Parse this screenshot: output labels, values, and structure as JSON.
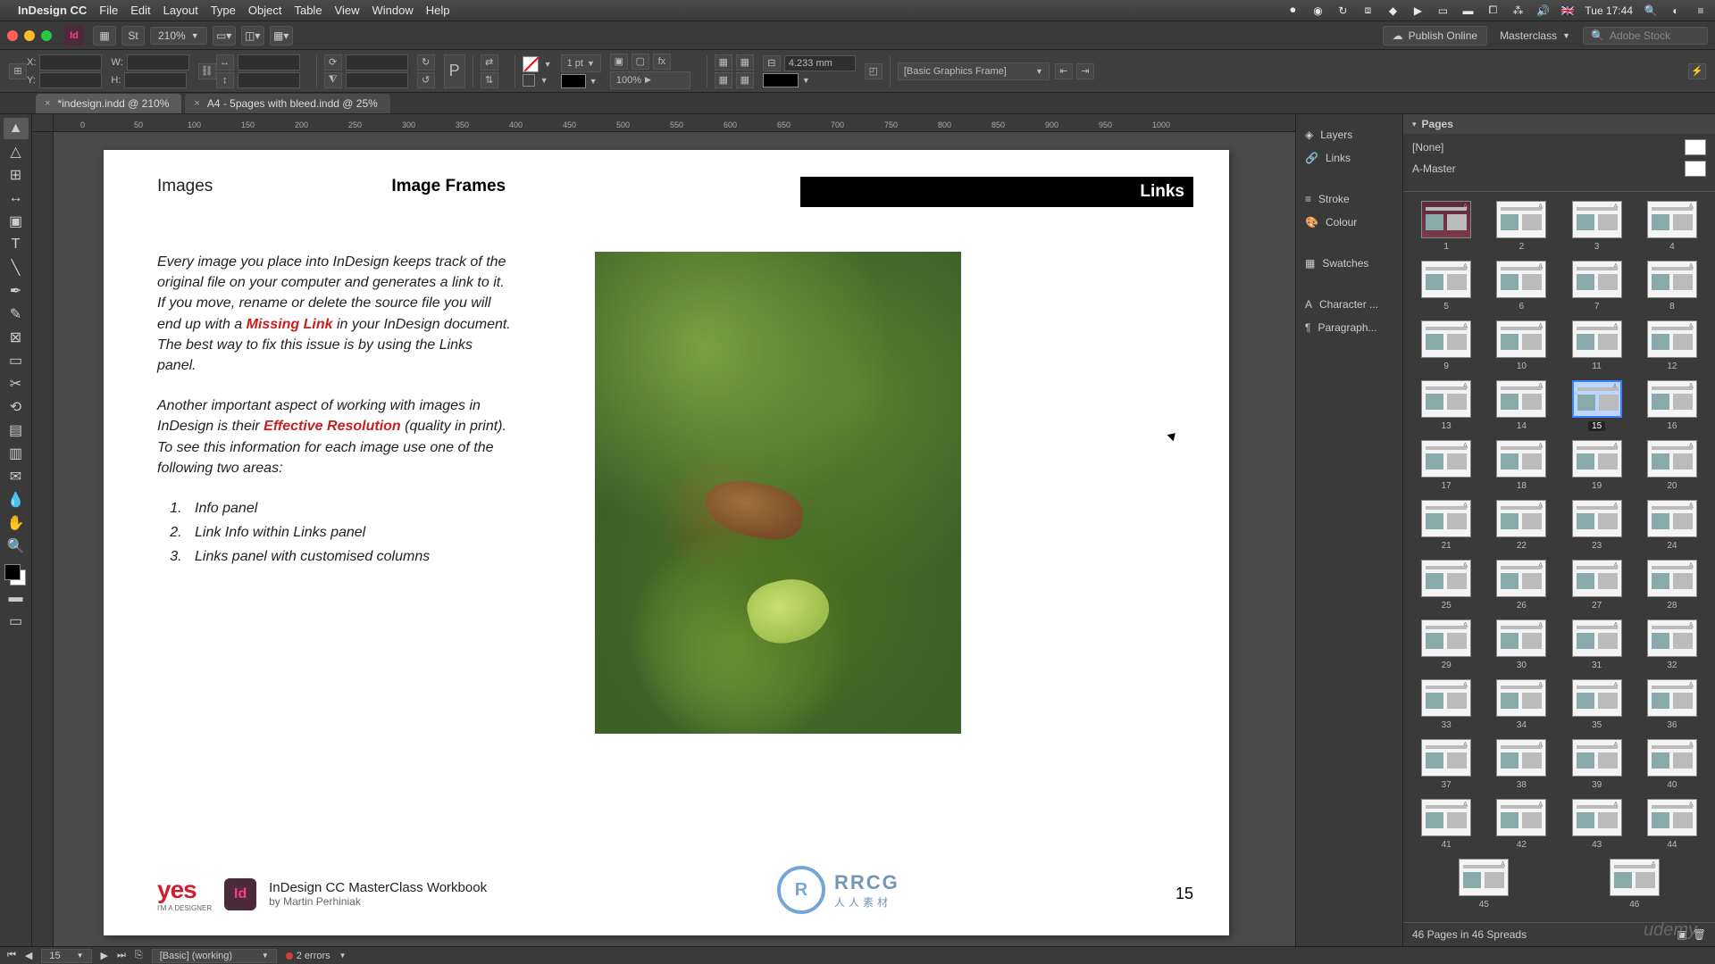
{
  "menubar": {
    "app": "InDesign CC",
    "items": [
      "File",
      "Edit",
      "Layout",
      "Type",
      "Object",
      "Table",
      "View",
      "Window",
      "Help"
    ],
    "clock": "Tue 17:44",
    "lang": "🇬🇧"
  },
  "toolbar": {
    "zoom": "210%",
    "publish": "Publish Online",
    "workspace": "Masterclass",
    "stock_placeholder": "Adobe Stock"
  },
  "control": {
    "x_label": "X:",
    "y_label": "Y:",
    "w_label": "W:",
    "h_label": "H:",
    "stroke_pt": "1 pt",
    "scale": "100%",
    "gap": "4.233 mm",
    "style": "[Basic Graphics Frame]"
  },
  "tabs": {
    "t1": "*indesign.indd @ 210%",
    "t2": "A4 - 5pages with bleed.indd @ 25%"
  },
  "ruler_marks": [
    "0",
    "50",
    "100",
    "150",
    "200",
    "250",
    "300",
    "350",
    "400",
    "450",
    "500",
    "550",
    "600",
    "650",
    "700",
    "750",
    "800",
    "850",
    "900",
    "950",
    "1000"
  ],
  "page": {
    "hdr_left": "Images",
    "hdr_center": "Image Frames",
    "hdr_right": "Links",
    "para1a": "Every image you place into InDesign keeps track of the original file on your computer and generates a link to it. If you move, rename or delete the source file you will end up with a ",
    "missing": "Missing Link",
    "para1b": " in your InDesign document. The best way to fix this issue is by using the Links panel.",
    "para2a": "Another important aspect of working with images in InDesign is their ",
    "effres": "Effective Resolution",
    "para2b": " (quality in print). To see this information for each image use one of the following two areas:",
    "li1": "Info panel",
    "li2": "Link Info within Links panel",
    "li3": "Links panel with customised columns",
    "yes": "yes",
    "yes_sub": "I'M A DESIGNER",
    "id_badge": "Id",
    "wb_title": "InDesign CC MasterClass Workbook",
    "wb_auth": "by Martin Perhiniak",
    "page_no": "15"
  },
  "panels": {
    "stack": [
      "Layers",
      "Links",
      "Stroke",
      "Colour",
      "Swatches",
      "Character ...",
      "Paragraph..."
    ],
    "pages_title": "Pages",
    "none": "[None]",
    "amaster": "A-Master",
    "count": "46 Pages in 46 Spreads",
    "selected": 15,
    "total": 46
  },
  "status": {
    "page_field": "15",
    "preset": "[Basic] (working)",
    "errors": "2 errors"
  },
  "watermark": {
    "circ": "R",
    "text": "RRCG",
    "sub": "人人素材",
    "udemy": "udemy"
  }
}
